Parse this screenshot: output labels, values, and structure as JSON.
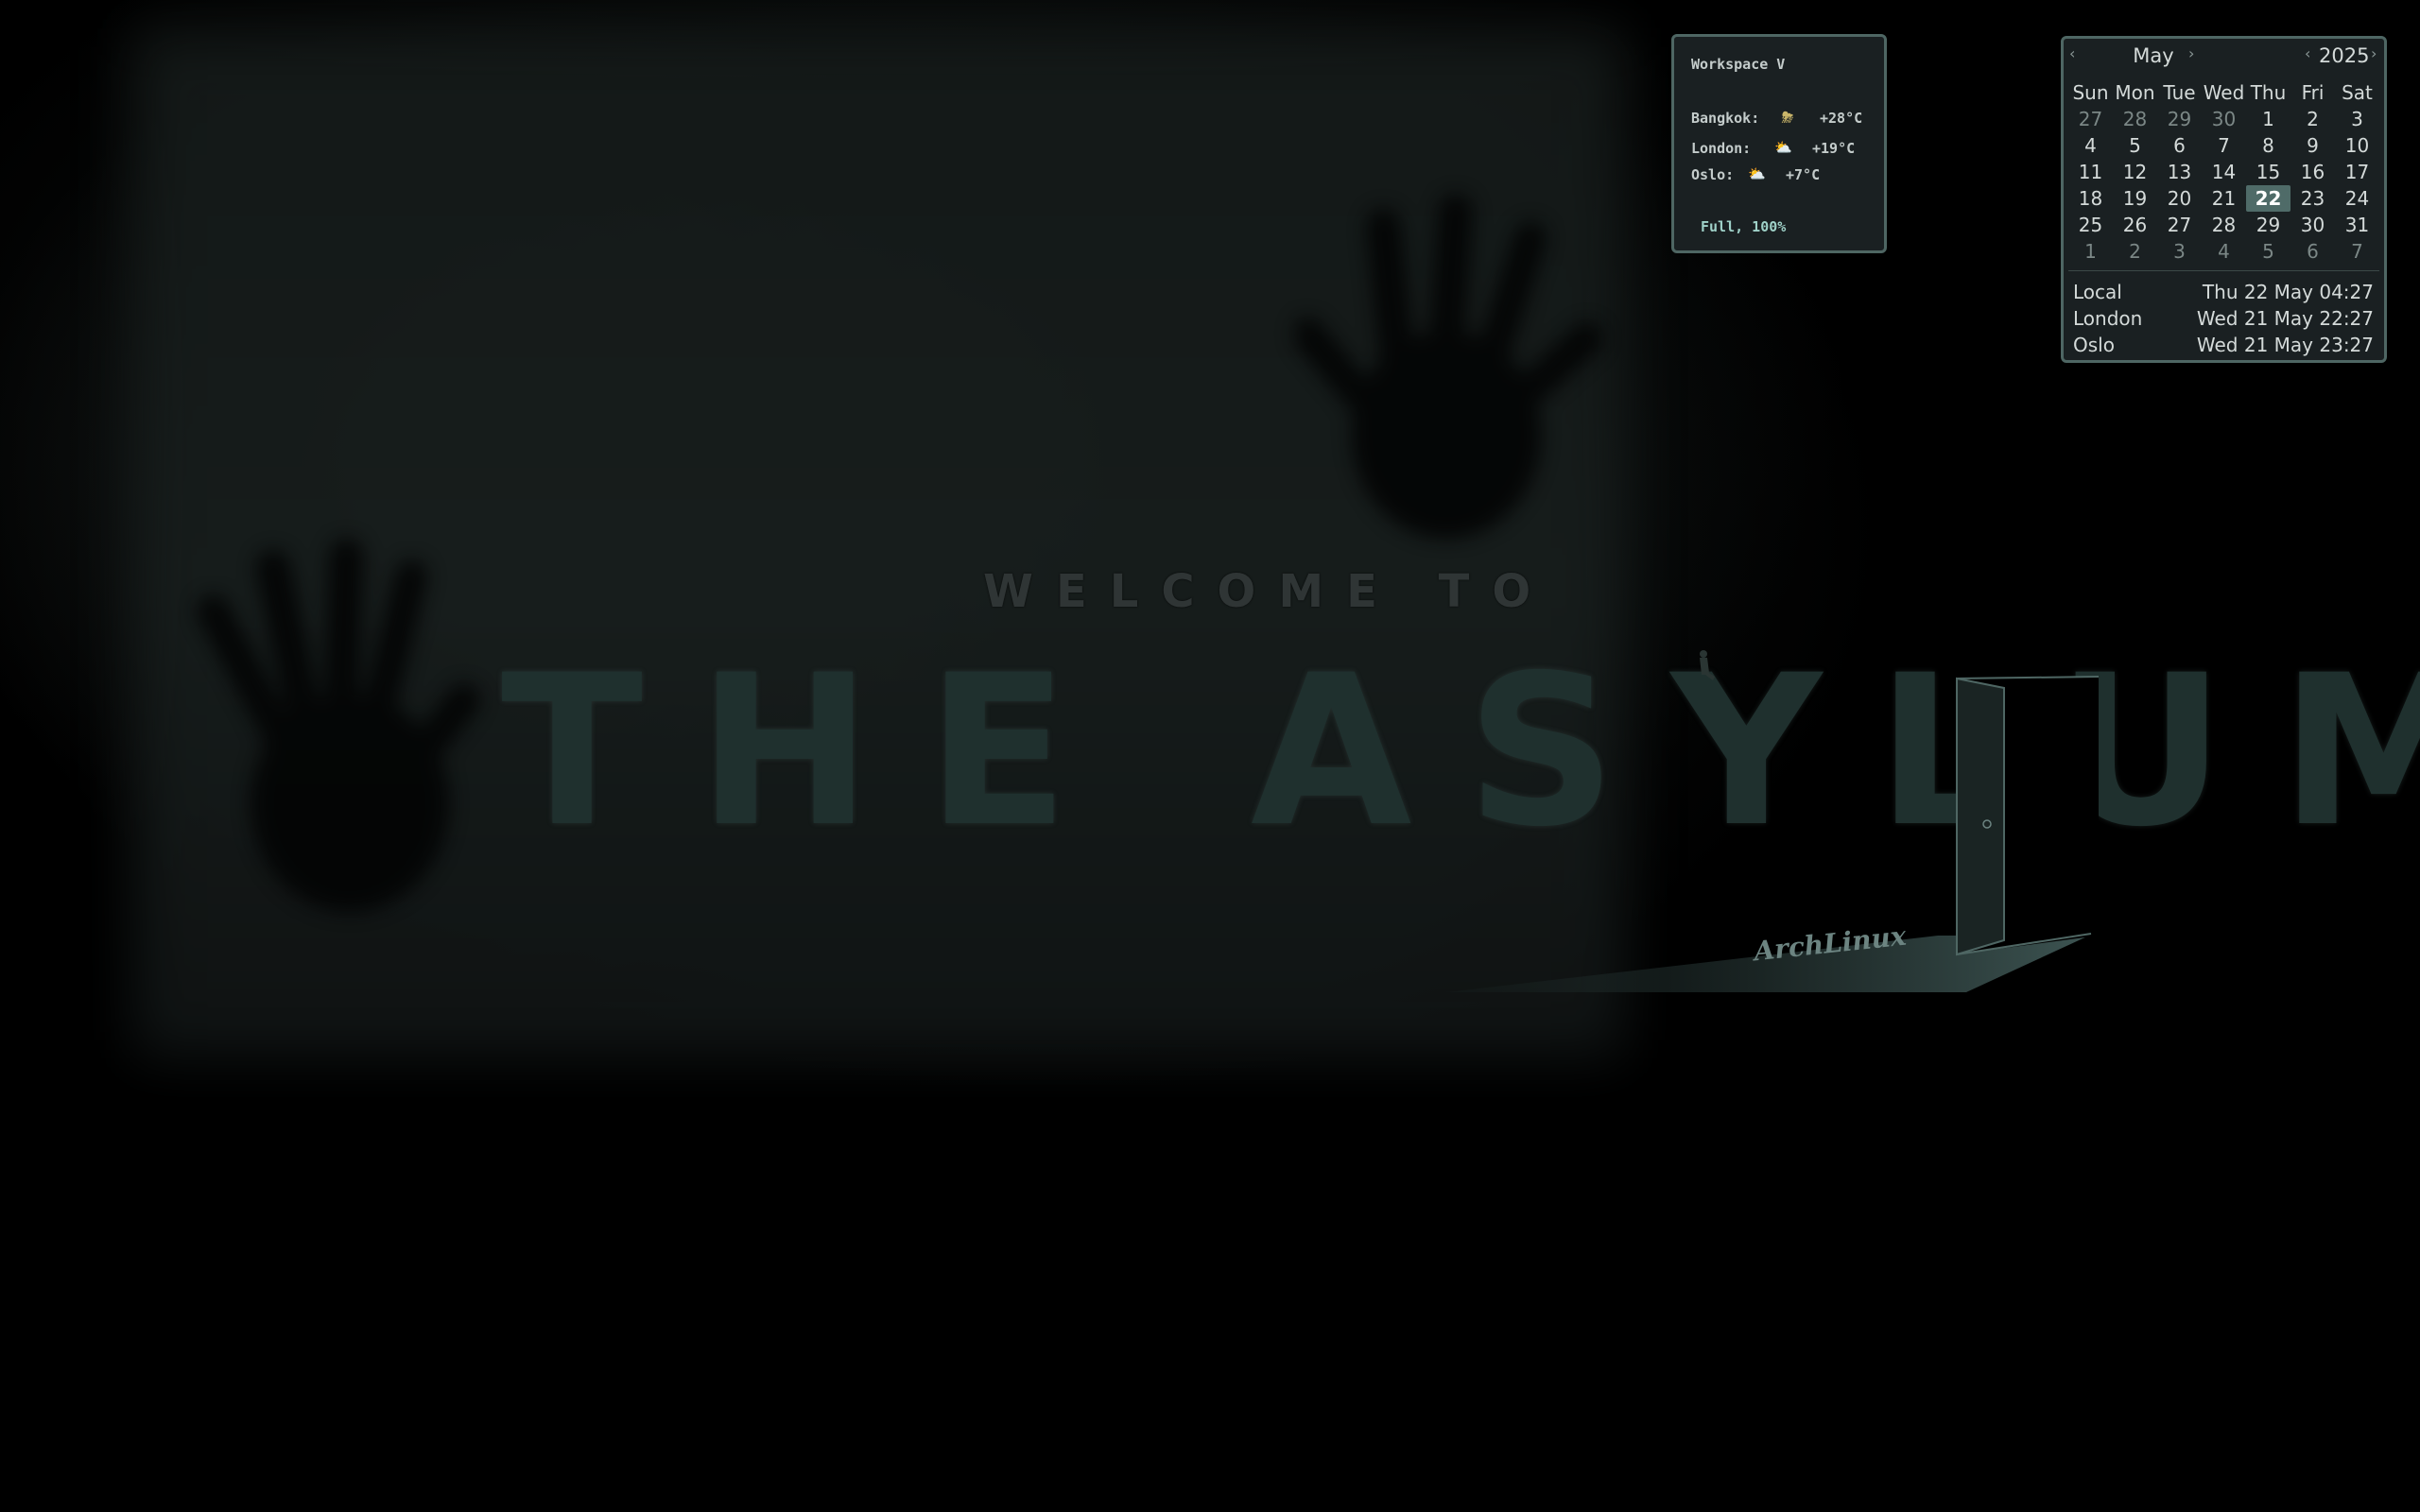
{
  "wallpaper": {
    "welcome": "WELCOME TO",
    "headline": "THE ASYLUM",
    "signature": "ArchLinux"
  },
  "conky": {
    "workspace": "Workspace V",
    "weather": [
      {
        "city": "Bangkok:",
        "icon": "thunderstorm-icon",
        "glyph": "⛈",
        "temp": "+28°C"
      },
      {
        "city": "London:",
        "icon": "partly-cloudy-icon",
        "glyph": "⛅",
        "temp": "+19°C"
      },
      {
        "city": "Oslo:",
        "icon": "partly-cloudy-icon",
        "glyph": "⛅",
        "temp": "+7°C"
      }
    ],
    "battery": "Full, 100%"
  },
  "calendar": {
    "prev_month": "‹",
    "next_month": "›",
    "month": "May",
    "prev_year": "‹",
    "next_year": "›",
    "year": "2025",
    "weekdays": [
      "Sun",
      "Mon",
      "Tue",
      "Wed",
      "Thu",
      "Fri",
      "Sat"
    ],
    "weeks": [
      [
        "27",
        "28",
        "29",
        "30",
        "1",
        "2",
        "3"
      ],
      [
        "4",
        "5",
        "6",
        "7",
        "8",
        "9",
        "10"
      ],
      [
        "11",
        "12",
        "13",
        "14",
        "15",
        "16",
        "17"
      ],
      [
        "18",
        "19",
        "20",
        "21",
        "22",
        "23",
        "24"
      ],
      [
        "25",
        "26",
        "27",
        "28",
        "29",
        "30",
        "31"
      ],
      [
        "1",
        "2",
        "3",
        "4",
        "5",
        "6",
        "7"
      ]
    ],
    "today": "22",
    "timezones": [
      {
        "name": "Local",
        "time": "Thu 22 May 04:27"
      },
      {
        "name": "London",
        "time": "Wed 21 May 22:27"
      },
      {
        "name": "Oslo",
        "time": "Wed 21 May 23:27"
      }
    ]
  },
  "colors": {
    "panel_bg": "#1a2022",
    "panel_border": "#4e6663",
    "accent": "#4f6b68"
  }
}
